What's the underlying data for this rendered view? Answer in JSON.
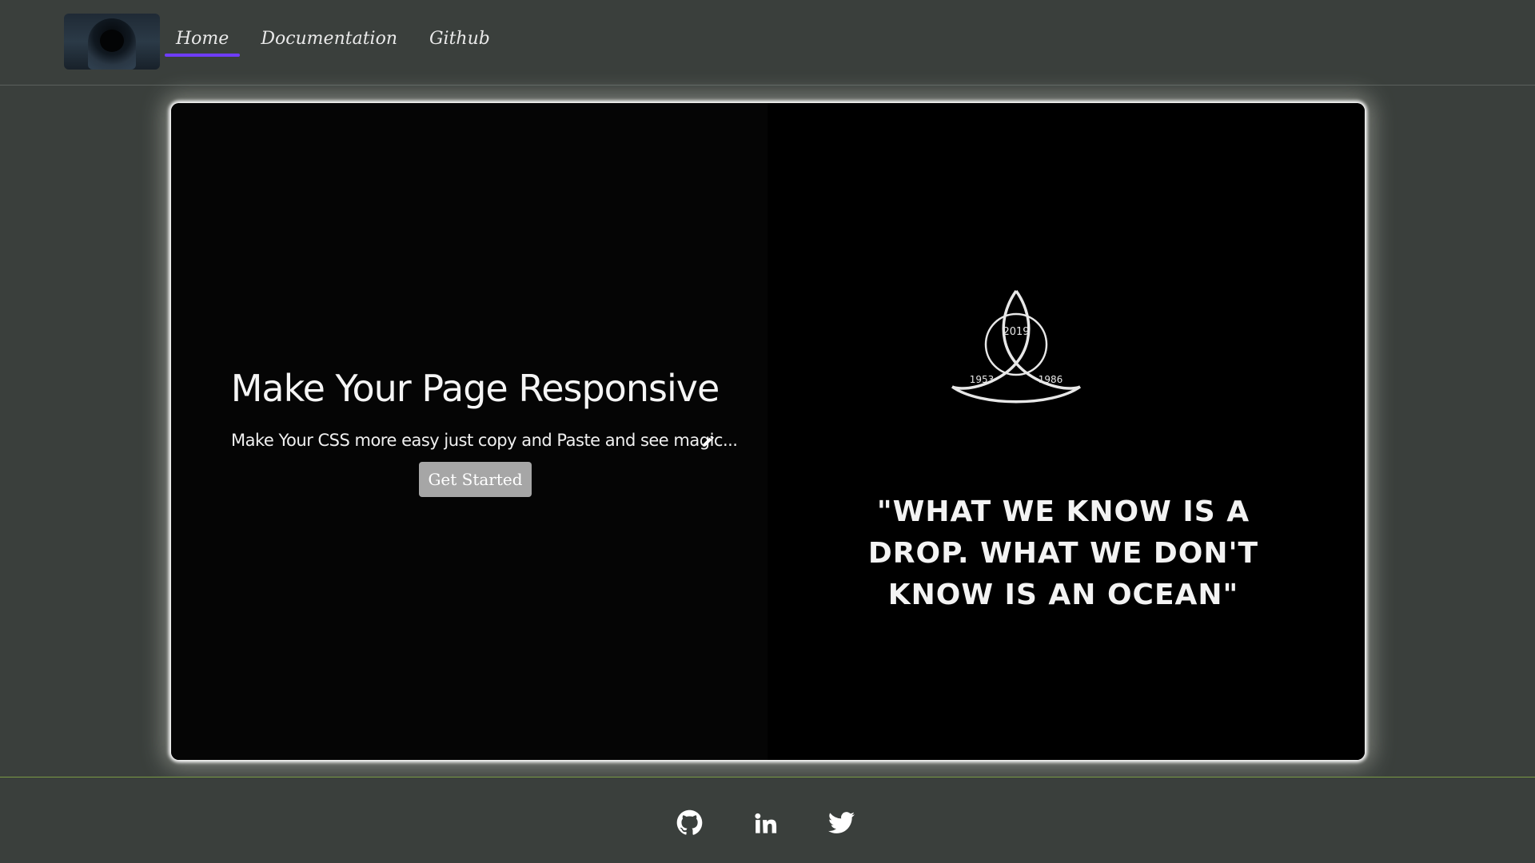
{
  "nav": {
    "items": [
      {
        "label": "Home",
        "active": true
      },
      {
        "label": "Documentation",
        "active": false
      },
      {
        "label": "Github",
        "active": false
      }
    ]
  },
  "hero": {
    "title": "Make Your Page Responsive",
    "subtitle": "Make Your CSS more easy just copy and Paste and see magic...",
    "cta_label": "Get Started",
    "emblem_years": [
      "2019",
      "1953",
      "1986"
    ],
    "quote": "\"WHAT WE KNOW IS A DROP. WHAT WE DON'T KNOW IS AN OCEAN\""
  },
  "footer": {
    "social_icons": [
      "github-icon",
      "linkedin-icon",
      "twitter-icon"
    ]
  },
  "colors": {
    "background": "#3a3f3c",
    "nav_underline": "#6f3cff",
    "hero_bg": "#000000",
    "button_bg": "#a6a6a6",
    "footer_border": "#7a9a45"
  }
}
